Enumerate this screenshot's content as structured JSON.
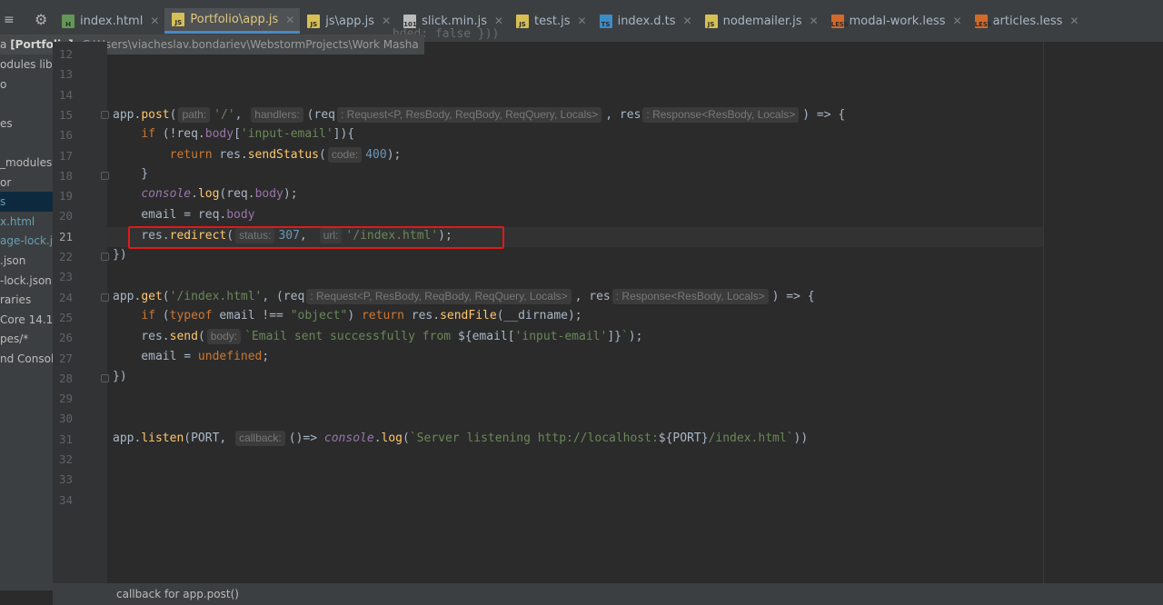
{
  "tabs": [
    {
      "label": "index.html",
      "icon": "html-file-icon",
      "icon_text": "H",
      "icon_color": "#629755",
      "active": false
    },
    {
      "label": "Portfolio\\app.js",
      "icon": "js-file-icon",
      "icon_text": "JS",
      "icon_color": "#d6bf55",
      "active": true
    },
    {
      "label": "js\\app.js",
      "icon": "js-file-icon",
      "icon_text": "JS",
      "icon_color": "#d6bf55",
      "active": false
    },
    {
      "label": "slick.min.js",
      "icon": "binary-file-icon",
      "icon_text": "101",
      "icon_color": "#bbbbbb",
      "active": false
    },
    {
      "label": "test.js",
      "icon": "js-file-icon",
      "icon_text": "JS",
      "icon_color": "#d6bf55",
      "active": false
    },
    {
      "label": "index.d.ts",
      "icon": "ts-file-icon",
      "icon_text": "TS",
      "icon_color": "#3c8cc8",
      "active": false
    },
    {
      "label": "nodemailer.js",
      "icon": "js-file-icon",
      "icon_text": "JS",
      "icon_color": "#d6bf55",
      "active": false
    },
    {
      "label": "modal-work.less",
      "icon": "less-file-icon",
      "icon_text": "LESS",
      "icon_color": "#d26a2a",
      "active": false
    },
    {
      "label": "articles.less",
      "icon": "less-file-icon",
      "icon_text": "LESS",
      "icon_color": "#d26a2a",
      "active": false
    }
  ],
  "breadcrumb": {
    "project_prefix": "a",
    "project": "[Portfolio]",
    "path": "C:\\Users\\viacheslav.bondariev\\WebstormProjects\\Work Masha"
  },
  "ghost_text": "hded: false }))",
  "project_tree": [
    "odules  lib",
    "o",
    "",
    "es",
    "",
    "_modules",
    "or",
    "s",
    "x.html",
    "age-lock.js",
    ".json",
    "-lock.json",
    "raries",
    "Core  14.1",
    "pes/*",
    "nd Console"
  ],
  "line_numbers": [
    "12",
    "13",
    "14",
    "15",
    "16",
    "17",
    "18",
    "19",
    "20",
    "21",
    "22",
    "23",
    "24",
    "25",
    "26",
    "27",
    "28",
    "29",
    "30",
    "31",
    "32",
    "33",
    "34"
  ],
  "code": {
    "l15": {
      "a": "app.",
      "b": "post",
      "c": "(",
      "h1": "path:",
      "s1": "'/'",
      "d": ", ",
      "h2": "handlers:",
      "e": "(req",
      "h3": ": Request<P, ResBody, ReqBody, ReqQuery, Locals>",
      "f": ", res",
      "h4": ": Response<ResBody, Locals>",
      "g": ") => {"
    },
    "l16": {
      "a": "    ",
      "kw": "if",
      "b": " (!req.",
      "prop": "body",
      "c": "[",
      "s": "'input-email'",
      "d": "]){"
    },
    "l17": {
      "a": "        ",
      "kw": "return",
      "b": " res.",
      "fn": "sendStatus",
      "c": "(",
      "h": "code:",
      "n": "400",
      "d": ");"
    },
    "l18": {
      "a": "    }"
    },
    "l19": {
      "a": "    ",
      "con": "console",
      "b": ".",
      "fn": "log",
      "c": "(req.",
      "prop": "body",
      "d": ");"
    },
    "l20": {
      "a": "    email = req.",
      "prop": "body"
    },
    "l21": {
      "a": "    res.",
      "fn": "redirect",
      "c": "(",
      "h1": "status:",
      "n": "307",
      "d": ",",
      "h2": "url:",
      "s": "'/index.html'",
      "e": ");"
    },
    "l22": {
      "a": "})"
    },
    "l24": {
      "a": "app.",
      "b": "get",
      "c": "(",
      "s": "'/index.html'",
      "d": ", (req",
      "h1": ": Request<P, ResBody, ReqBody, ReqQuery, Locals>",
      "e": ", res",
      "h2": ": Response<ResBody, Locals>",
      "f": ") => {"
    },
    "l25": {
      "a": "    ",
      "kw1": "if",
      "b": " (",
      "kw2": "typeof",
      "c": " email !== ",
      "s": "\"object\"",
      "d": ") ",
      "kw3": "return",
      "e": " res.",
      "fn": "sendFile",
      "f": "(__dirname);"
    },
    "l26": {
      "a": "    res.",
      "fn": "send",
      "c": "(",
      "h": "body:",
      "s1": "`Email sent successfully from ",
      "t": "${email[",
      "s2": "'input-email'",
      "t2": "]}",
      "s3": "`",
      "d": ");"
    },
    "l27": {
      "a": "    email = ",
      "kw": "undefined",
      "d": ";"
    },
    "l28": {
      "a": "})"
    },
    "l31": {
      "a": "app.",
      "fn": "listen",
      "b": "(PORT, ",
      "h": "callback:",
      "c": "()=> ",
      "con": "console",
      "d": ".",
      "fn2": "log",
      "e": "(",
      "s1": "`Server listening http://localhost:",
      "t": "${PORT}",
      "s2": "/index.html`",
      "f": "))"
    }
  },
  "status_text": "callback for app.post()"
}
